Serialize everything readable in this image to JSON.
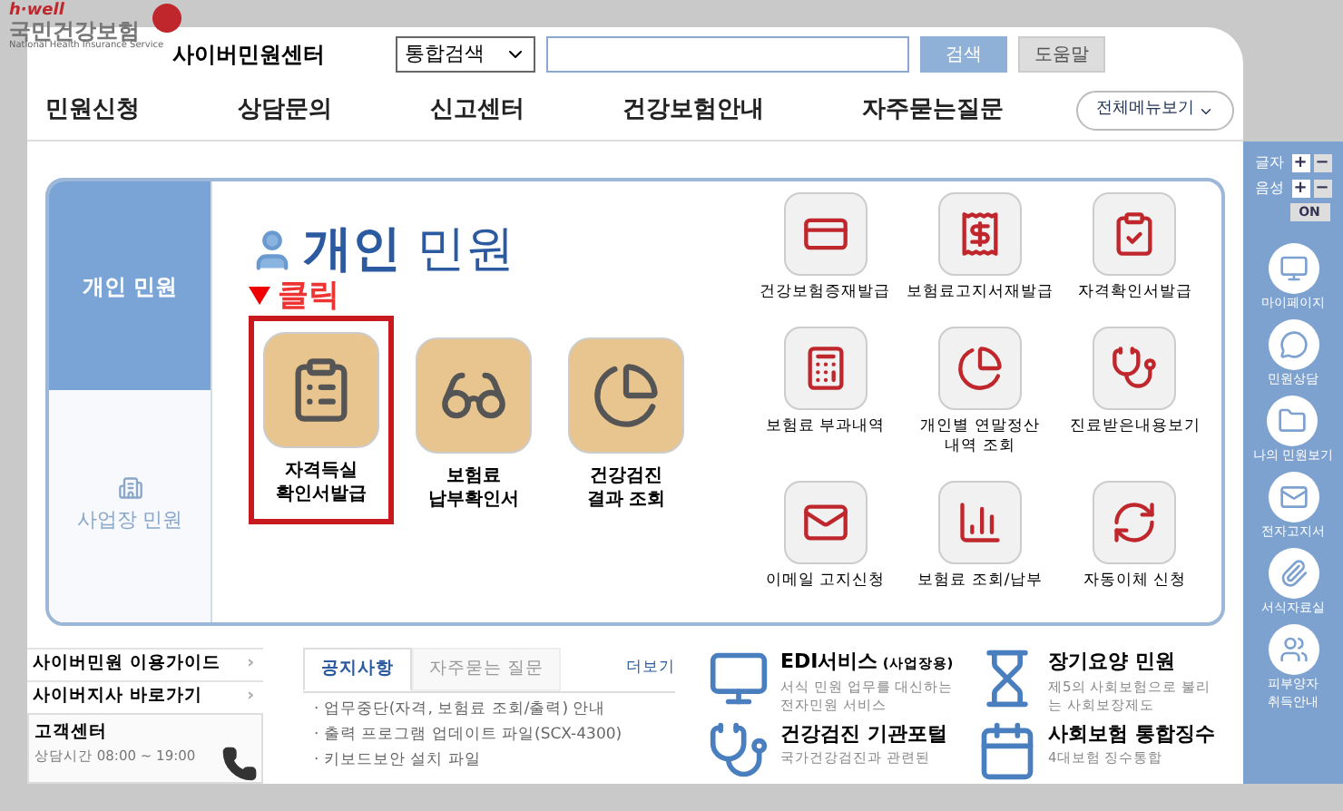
{
  "header": {
    "logo": {
      "brand": "h·well",
      "name": "국민건강보험",
      "sub": "National Health Insurance Service"
    },
    "site_title": "사이버민원센터",
    "search": {
      "scope": "통합검색",
      "button": "검색",
      "help": "도움말"
    }
  },
  "nav": {
    "items": [
      "민원신청",
      "상담문의",
      "신고센터",
      "건강보험안내",
      "자주묻는질문"
    ],
    "all_menu": "전체메뉴보기"
  },
  "side_tabs": [
    {
      "label": "개인 민원",
      "selected": true
    },
    {
      "label": "사업장 민원",
      "selected": false
    }
  ],
  "panel": {
    "title_bold": "개인",
    "title": "민원",
    "callout": "클릭",
    "featured": [
      {
        "lines": [
          "자격득실",
          "확인서발급"
        ],
        "highlighted": true
      },
      {
        "lines": [
          "보험료",
          "납부확인서"
        ],
        "highlighted": false
      },
      {
        "lines": [
          "건강검진",
          "결과 조회"
        ],
        "highlighted": false
      }
    ],
    "grid": [
      {
        "lines": [
          "건강보험증재발급"
        ]
      },
      {
        "lines": [
          "보험료고지서재발급"
        ]
      },
      {
        "lines": [
          "자격확인서발급"
        ]
      },
      {
        "lines": [
          "보험료 부과내역"
        ]
      },
      {
        "lines": [
          "개인별 연말정산",
          "내역 조회"
        ]
      },
      {
        "lines": [
          "진료받은내용보기"
        ]
      },
      {
        "lines": [
          "이메일 고지신청"
        ]
      },
      {
        "lines": [
          "보험료 조회/납부"
        ]
      },
      {
        "lines": [
          "자동이체 신청"
        ]
      }
    ]
  },
  "right_bar": {
    "text_size": {
      "label": "글자",
      "plus": "+",
      "minus": "−"
    },
    "voice": {
      "label": "음성",
      "plus": "+",
      "minus": "−",
      "toggle": "ON"
    },
    "items": [
      {
        "lines": [
          "마이페이지"
        ]
      },
      {
        "lines": [
          "민원상담"
        ]
      },
      {
        "lines": [
          "나의 민원보기"
        ]
      },
      {
        "lines": [
          "전자고지서"
        ]
      },
      {
        "lines": [
          "서식자료실"
        ]
      },
      {
        "lines": [
          "피부양자",
          "취득안내"
        ]
      }
    ]
  },
  "left_links": [
    {
      "label": "사이버민원 이용가이드",
      "arrow": "›"
    },
    {
      "label": "사이버지사 바로가기",
      "arrow": "›"
    }
  ],
  "customer_center": {
    "title": "고객센터",
    "hours": "상담시간 08:00 ~ 19:00"
  },
  "notices": {
    "tabs": [
      {
        "label": "공지사항",
        "selected": true
      },
      {
        "label": "자주묻는 질문",
        "selected": false
      }
    ],
    "more": "더보기",
    "items": [
      "· 업무중단(자격, 보험료 조회/출력) 안내",
      "· 출력 프로그램 업데이트 파일(SCX-4300)",
      "· 키보드보안 설치 파일"
    ]
  },
  "services": [
    {
      "title": "EDI서비스",
      "tag": "(사업장용)",
      "desc": [
        "서식 민원 업무를 대신하는",
        "전자민원 서비스"
      ]
    },
    {
      "title": "장기요양 민원",
      "desc": [
        "제5의 사회보험으로 불리",
        "는 사회보장제도"
      ]
    },
    {
      "title": "건강검진 기관포털",
      "desc": [
        "국가건강검진과 관련된"
      ]
    },
    {
      "title": "사회보험 통합징수",
      "desc": [
        "4대보험 징수통합"
      ]
    }
  ]
}
